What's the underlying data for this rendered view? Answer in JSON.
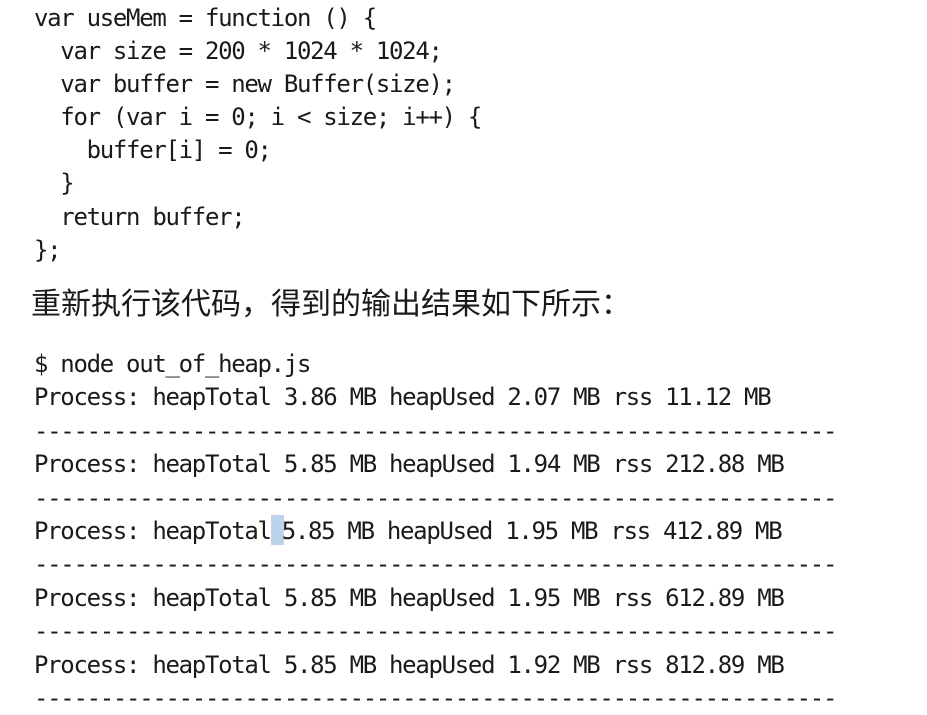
{
  "code": {
    "lines": [
      "var useMem = function () {",
      "  var size = 200 * 1024 * 1024;",
      "  var buffer = new Buffer(size);",
      "  for (var i = 0; i < size; i++) {",
      "    buffer[i] = 0;",
      "  }",
      "  return buffer;",
      "};"
    ]
  },
  "prose": {
    "text": "重新执行该代码，得到的输出结果如下所示："
  },
  "output": {
    "command": "$ node out_of_heap.js",
    "separator": "-------------------------------------------------------------",
    "rows": [
      "Process: heapTotal 3.86 MB heapUsed 2.07 MB rss 11.12 MB",
      "Process: heapTotal 5.85 MB heapUsed 1.94 MB rss 212.88 MB",
      "Process: heapTotal 5.85 MB heapUsed 1.95 MB rss 412.89 MB",
      "Process: heapTotal 5.85 MB heapUsed 1.95 MB rss 612.89 MB",
      "Process: heapTotal 5.85 MB heapUsed 1.92 MB rss 812.89 MB"
    ],
    "row3_before_caret": "Process: heapTotal",
    "row3_after_caret": "5.85 MB heapUsed 1.95 MB rss 412.89 MB"
  }
}
